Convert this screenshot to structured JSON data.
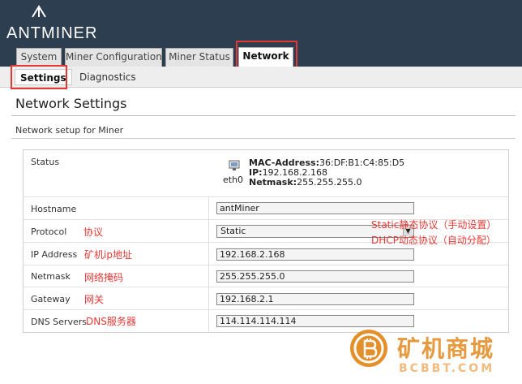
{
  "header": {
    "logo_text": "ANTMINER"
  },
  "tabs": [
    {
      "label": "System"
    },
    {
      "label": "Miner Configuration"
    },
    {
      "label": "Miner Status"
    },
    {
      "label": "Network"
    }
  ],
  "subtabs": [
    {
      "label": "Settings"
    },
    {
      "label": "Diagnostics"
    }
  ],
  "page": {
    "title": "Network Settings",
    "section_desc": "Network setup for Miner"
  },
  "status": {
    "label": "Status",
    "interface": "eth0",
    "mac_label": "MAC-Address:",
    "mac_value": "36:DF:B1:C4:85:D5",
    "ip_label": "IP:",
    "ip_value": "192.168.2.168",
    "netmask_label": "Netmask:",
    "netmask_value": "255.255.255.0"
  },
  "form": {
    "hostname": {
      "label": "Hostname",
      "value": "antMiner"
    },
    "protocol": {
      "label": "Protocol",
      "value": "Static"
    },
    "ip_address": {
      "label": "IP Address",
      "value": "192.168.2.168"
    },
    "netmask": {
      "label": "Netmask",
      "value": "255.255.255.0"
    },
    "gateway": {
      "label": "Gateway",
      "value": "192.168.2.1"
    },
    "dns_servers": {
      "label": "DNS Servers",
      "value": "114.114.114.114"
    }
  },
  "annotations": {
    "protocol": "协议",
    "ip_address": "矿机ip地址",
    "netmask": "网络掩码",
    "gateway": "网关",
    "dns": "DNS服务器",
    "static_note": "Static静态协议（手动设置）",
    "dhcp_note": "DHCP动态协议（自动分配）"
  },
  "watermark": {
    "text": "矿机商城",
    "sub": "BCBBT.COM"
  },
  "colors": {
    "header_bg": "#2c3e50",
    "annotation_red": "#e53935",
    "watermark_orange": "#e58f2a"
  }
}
